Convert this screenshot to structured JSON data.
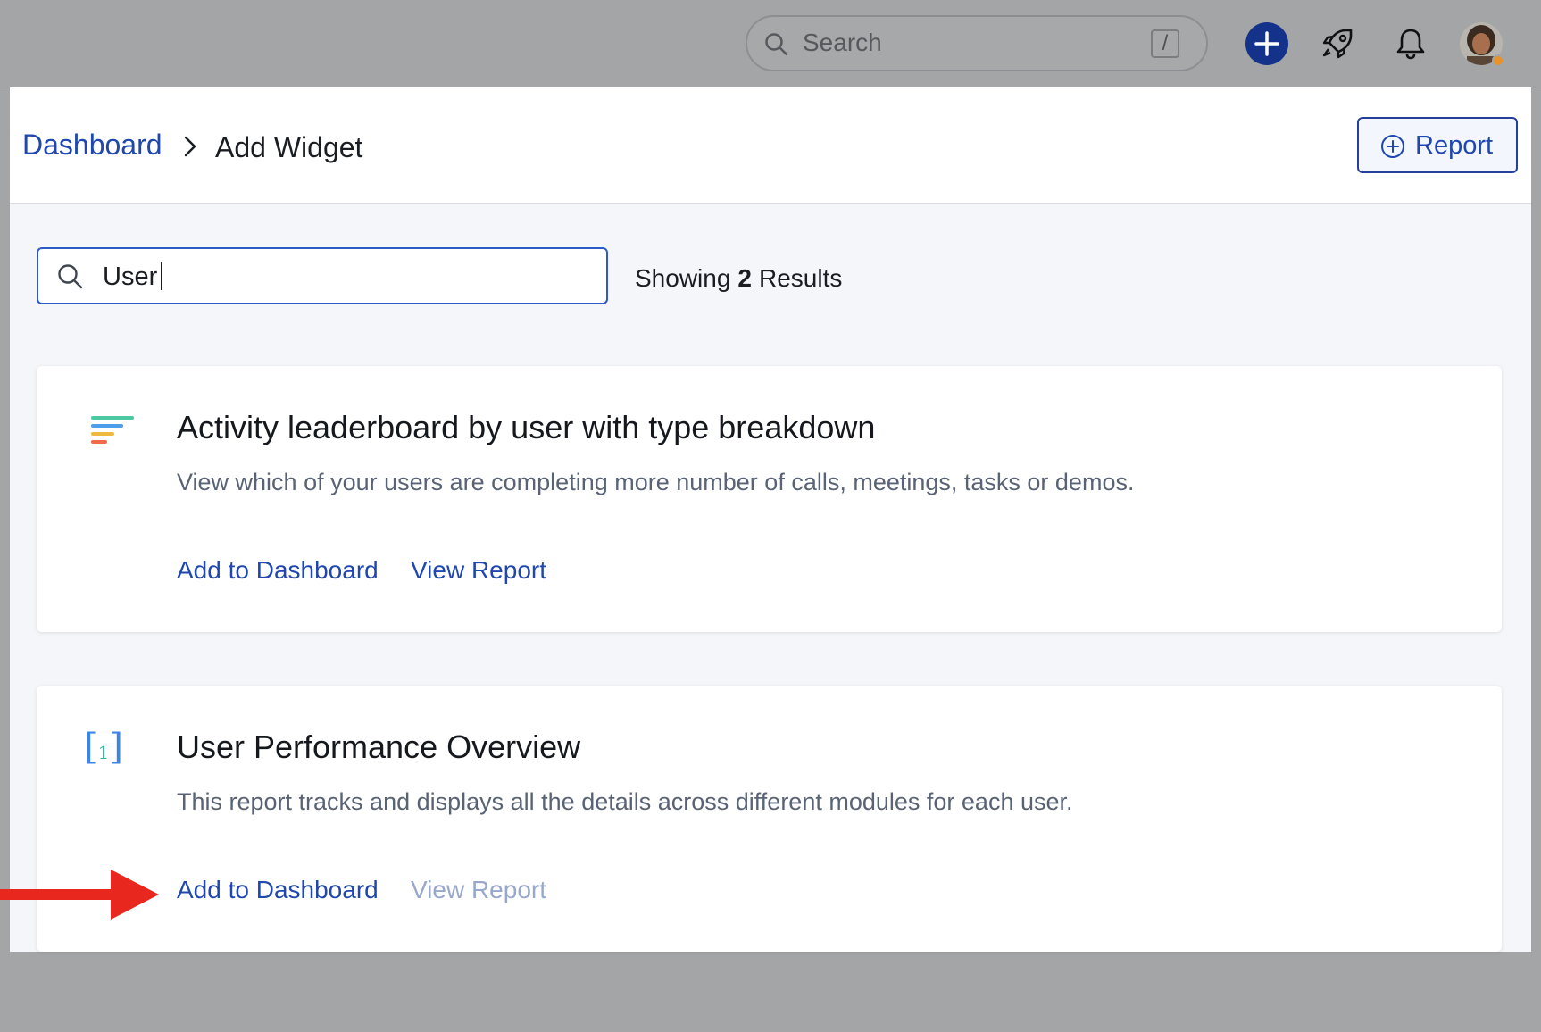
{
  "topbar": {
    "search_placeholder": "Search",
    "search_shortcut": "/"
  },
  "header": {
    "breadcrumb_parent": "Dashboard",
    "breadcrumb_current": "Add Widget",
    "report_button_label": "Report"
  },
  "widget_search": {
    "value": "User"
  },
  "results": {
    "prefix": "Showing",
    "count": "2",
    "suffix": "Results"
  },
  "cards": [
    {
      "icon": "leaderboard-bars-icon",
      "title": "Activity leaderboard by user with type breakdown",
      "description": "View which of your users are completing more number of calls, meetings, tasks or demos.",
      "add_label": "Add to Dashboard",
      "view_label": "View Report"
    },
    {
      "icon": "number-bracket-icon",
      "title": "User Performance Overview",
      "description": "This report tracks and displays all the details across different modules for each user.",
      "add_label": "Add to Dashboard",
      "view_label": "View Report",
      "bracket_number": "1"
    }
  ],
  "colors": {
    "accent": "#1f47ad",
    "primary_button": "#14328a",
    "annotation_arrow": "#e8281e"
  }
}
